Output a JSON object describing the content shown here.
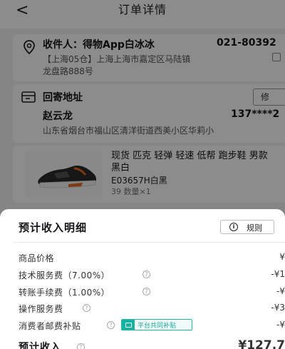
{
  "nav": {
    "back": "<",
    "title": "订单详情"
  },
  "address": {
    "label": "收件人：得物App白冰冰",
    "phone": "021-80392",
    "line2": "【上海05仓】上海上海市嘉定区马陆镇",
    "line3": "龙盘路888号"
  },
  "return_address": {
    "title": "回寄地址",
    "modify_label": "修",
    "name": "赵云龙",
    "phone": "137****2",
    "address": "山东省烟台市福山区清洋街道西美小区华莉小"
  },
  "product": {
    "name": "现货 匹克 轻弹 轻速 低帮 跑步鞋 男款 黑白",
    "code": "E03657H白黑",
    "size_qty": "39 数量×1",
    "price_prefix": "¥"
  },
  "sheet": {
    "title": "预计收入明细",
    "rules_label": "规则",
    "rows": [
      {
        "label": "商品价格",
        "value": "¥"
      },
      {
        "label": "技术服务费（7.00%）",
        "value": "-¥1"
      },
      {
        "label": "转账手续费（1.00%）",
        "value": "-¥"
      },
      {
        "label": "操作服务费",
        "value": "-¥3"
      },
      {
        "label": "消费者邮费补贴",
        "value": "-¥",
        "badge": "平台共同补贴"
      }
    ],
    "total_label": "预计收入",
    "total_value": "¥127.7"
  },
  "colors": {
    "accent_teal": "#15b3a1",
    "mask": "rgba(0,0,0,0.45)"
  }
}
